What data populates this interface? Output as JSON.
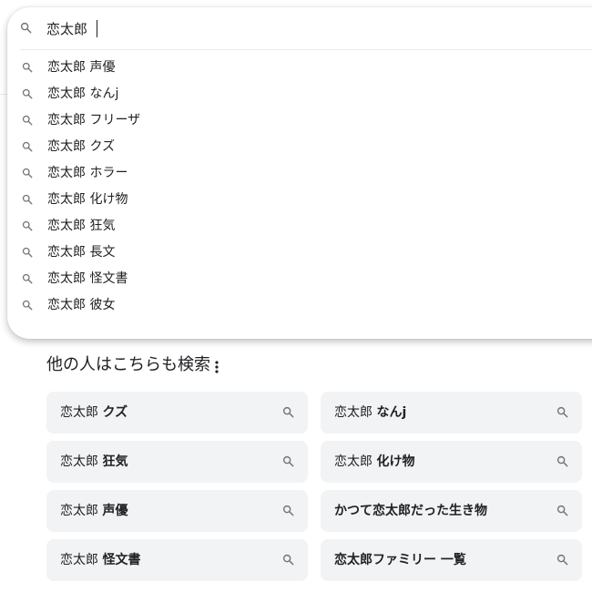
{
  "search": {
    "query": "恋太郎",
    "icon": "search-icon"
  },
  "suggestions": [
    {
      "prefix": "恋太郎",
      "suffix": "声優"
    },
    {
      "prefix": "恋太郎",
      "suffix": "なんj"
    },
    {
      "prefix": "恋太郎",
      "suffix": "フリーザ"
    },
    {
      "prefix": "恋太郎",
      "suffix": "クズ"
    },
    {
      "prefix": "恋太郎",
      "suffix": "ホラー"
    },
    {
      "prefix": "恋太郎",
      "suffix": "化け物"
    },
    {
      "prefix": "恋太郎",
      "suffix": "狂気"
    },
    {
      "prefix": "恋太郎",
      "suffix": "長文"
    },
    {
      "prefix": "恋太郎",
      "suffix": "怪文書"
    },
    {
      "prefix": "恋太郎",
      "suffix": "彼女"
    }
  ],
  "related": {
    "title": "他の人はこちらも検索",
    "more_icon": "more-vert-icon",
    "chips": [
      {
        "normal": "恋太郎 ",
        "bold": "クズ"
      },
      {
        "normal": "恋太郎 ",
        "bold": "なんj"
      },
      {
        "normal": "恋太郎 ",
        "bold": "狂気"
      },
      {
        "normal": "恋太郎 ",
        "bold": "化け物"
      },
      {
        "normal": "恋太郎 ",
        "bold": "声優"
      },
      {
        "normal": "",
        "bold": "かつて恋太郎だった生き物"
      },
      {
        "normal": "恋太郎 ",
        "bold": "怪文書"
      },
      {
        "normal": "",
        "bold": "恋太郎ファミリー 一覧"
      }
    ]
  },
  "colors": {
    "text": "#202124",
    "icon": "#70757a",
    "chip_bg": "#f1f3f4",
    "divider": "#e8eaed"
  }
}
